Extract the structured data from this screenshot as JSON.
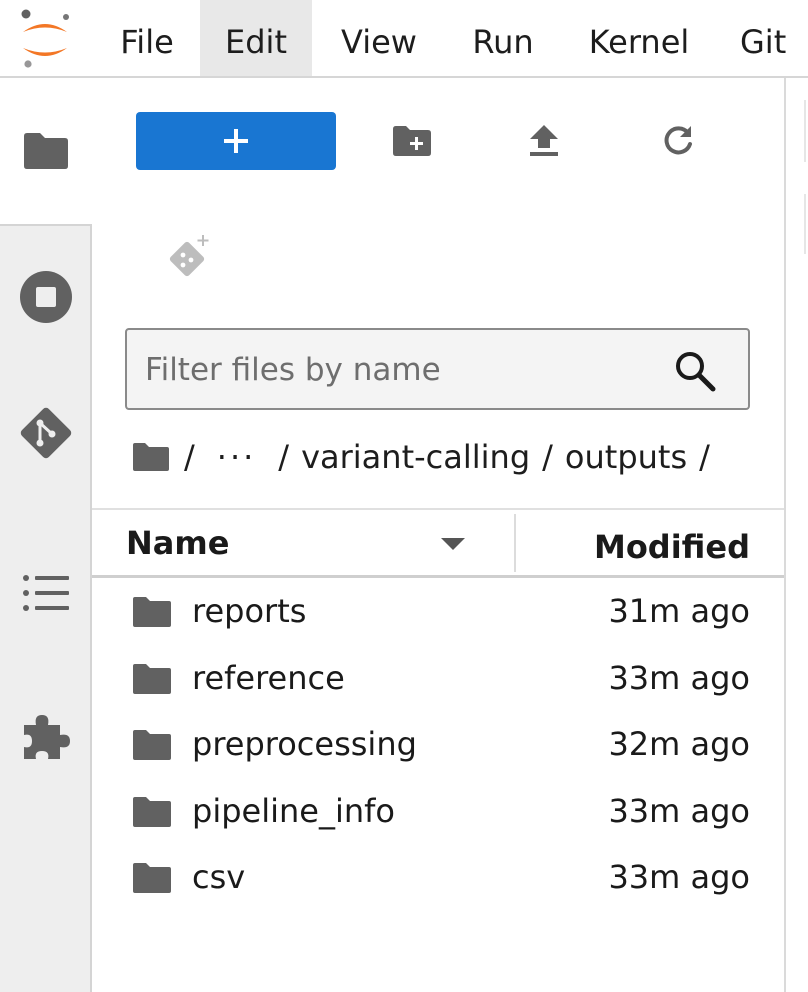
{
  "menubar": {
    "items": [
      "File",
      "Edit",
      "View",
      "Run",
      "Kernel",
      "Git"
    ],
    "active": "Edit"
  },
  "activity_bar": {
    "tabs": [
      "folder-icon",
      "running-stop-icon",
      "git-icon",
      "table-of-contents-icon",
      "extension-puzzle-icon"
    ],
    "active": "folder-icon"
  },
  "toolbar": {
    "new_launcher_label": "+",
    "icons": [
      "new-folder-icon",
      "upload-icon",
      "refresh-icon",
      "git-clone-icon"
    ],
    "accent": "#1976d2"
  },
  "filter": {
    "placeholder": "Filter files by name",
    "value": ""
  },
  "breadcrumbs": {
    "root": "/",
    "ellipsis": "···",
    "parts": [
      "variant-calling",
      "outputs"
    ],
    "separator": "/"
  },
  "list": {
    "columns": {
      "name": "Name",
      "modified": "Modified"
    },
    "items": [
      {
        "name": "reports",
        "modified": "31m ago"
      },
      {
        "name": "reference",
        "modified": "33m ago"
      },
      {
        "name": "preprocessing",
        "modified": "32m ago"
      },
      {
        "name": "pipeline_info",
        "modified": "33m ago"
      },
      {
        "name": "csv",
        "modified": "33m ago"
      }
    ]
  }
}
